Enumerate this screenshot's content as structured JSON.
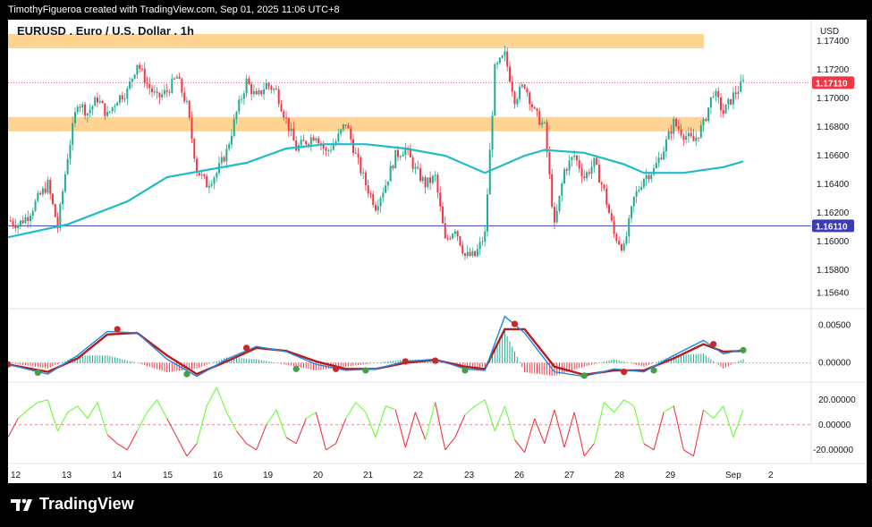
{
  "header": {
    "caption": "TimothyFigueroa created with TradingView.com, Sep 01, 2025 11:06 UTC+8"
  },
  "chart": {
    "symbol_title": "EURUSD . Euro / U.S. Dollar . 1h",
    "currency": "USD",
    "price_badge": "1.17110",
    "level_badge": "1.16110"
  },
  "brand": {
    "name": "TradingView",
    "icon": "tradingview-logo-icon"
  },
  "colors": {
    "up": "#22ab94",
    "down": "#f23645",
    "ma": "#1fbcc6",
    "zone": "#ffcc80",
    "macd_fast": "#1e88e5",
    "macd_slow": "#b71c1c",
    "osc_up": "#66ff33",
    "osc_down": "#f23645",
    "badge_red": "#f23645",
    "badge_blue": "#3b3bb3"
  },
  "chart_data": {
    "type": "candlestick",
    "timeframe": "1h",
    "price_axis": {
      "range": [
        1.1555,
        1.1755
      ],
      "ticks": [
        "1.17400",
        "1.17200",
        "1.17000",
        "1.16800",
        "1.16600",
        "1.16400",
        "1.16200",
        "1.16000",
        "1.15800",
        "1.15640"
      ]
    },
    "x_ticks": [
      "12",
      "13",
      "14",
      "15",
      "16",
      "19",
      "20",
      "21",
      "22",
      "23",
      "26",
      "27",
      "28",
      "29",
      "Sep",
      "2"
    ],
    "close_path": [
      [
        0,
        1.1615
      ],
      [
        1,
        1.1612
      ],
      [
        2,
        1.1618
      ],
      [
        3,
        1.163
      ],
      [
        4,
        1.164
      ],
      [
        5,
        1.161
      ],
      [
        6,
        1.166
      ],
      [
        7,
        1.1698
      ],
      [
        8,
        1.169
      ],
      [
        9,
        1.17
      ],
      [
        10,
        1.1688
      ],
      [
        11,
        1.17
      ],
      [
        12,
        1.1705
      ],
      [
        13,
        1.1725
      ],
      [
        14,
        1.171
      ],
      [
        15,
        1.17
      ],
      [
        16,
        1.1705
      ],
      [
        17,
        1.1715
      ],
      [
        18,
        1.1695
      ],
      [
        19,
        1.165
      ],
      [
        20,
        1.164
      ],
      [
        21,
        1.1648
      ],
      [
        22,
        1.1663
      ],
      [
        23,
        1.169
      ],
      [
        24,
        1.1712
      ],
      [
        25,
        1.17
      ],
      [
        26,
        1.171
      ],
      [
        27,
        1.1705
      ],
      [
        28,
        1.1685
      ],
      [
        29,
        1.1665
      ],
      [
        30,
        1.167
      ],
      [
        31,
        1.1675
      ],
      [
        32,
        1.1662
      ],
      [
        33,
        1.167
      ],
      [
        34,
        1.1683
      ],
      [
        35,
        1.166
      ],
      [
        36,
        1.164
      ],
      [
        37,
        1.1625
      ],
      [
        38,
        1.164
      ],
      [
        39,
        1.166
      ],
      [
        40,
        1.1665
      ],
      [
        41,
        1.165
      ],
      [
        42,
        1.164
      ],
      [
        43,
        1.1645
      ],
      [
        44,
        1.16
      ],
      [
        45,
        1.161
      ],
      [
        46,
        1.159
      ],
      [
        47,
        1.159
      ],
      [
        48,
        1.1605
      ],
      [
        49,
        1.172
      ],
      [
        50,
        1.173
      ],
      [
        51,
        1.17
      ],
      [
        52,
        1.171
      ],
      [
        53,
        1.169
      ],
      [
        54,
        1.168
      ],
      [
        55,
        1.161
      ],
      [
        56,
        1.165
      ],
      [
        57,
        1.166
      ],
      [
        58,
        1.1645
      ],
      [
        59,
        1.1655
      ],
      [
        60,
        1.1635
      ],
      [
        61,
        1.1605
      ],
      [
        62,
        1.1595
      ],
      [
        63,
        1.163
      ],
      [
        64,
        1.1645
      ],
      [
        65,
        1.165
      ],
      [
        66,
        1.1665
      ],
      [
        67,
        1.1683
      ],
      [
        68,
        1.1675
      ],
      [
        69,
        1.167
      ],
      [
        70,
        1.1682
      ],
      [
        71,
        1.1705
      ],
      [
        72,
        1.169
      ],
      [
        73,
        1.1702
      ],
      [
        74,
        1.1711
      ]
    ],
    "moving_average": [
      [
        0,
        1.1603
      ],
      [
        6,
        1.1612
      ],
      [
        12,
        1.1628
      ],
      [
        16,
        1.1645
      ],
      [
        20,
        1.165
      ],
      [
        24,
        1.1655
      ],
      [
        28,
        1.1665
      ],
      [
        32,
        1.1668
      ],
      [
        36,
        1.1668
      ],
      [
        40,
        1.1665
      ],
      [
        44,
        1.166
      ],
      [
        48,
        1.1648
      ],
      [
        52,
        1.166
      ],
      [
        54,
        1.1664
      ],
      [
        58,
        1.1662
      ],
      [
        62,
        1.1654
      ],
      [
        64,
        1.1648
      ],
      [
        68,
        1.1648
      ],
      [
        72,
        1.1652
      ],
      [
        74,
        1.1656
      ]
    ],
    "resistance_zones": [
      [
        1.1735,
        1.1745
      ],
      [
        1.1677,
        1.1687
      ]
    ],
    "reference_lines": [
      1.1711,
      1.1611
    ],
    "macd": {
      "axis_ticks": [
        "0.00500",
        "0.00000"
      ],
      "range": [
        -0.0022,
        0.007
      ],
      "fast": [
        [
          0,
          -0.0002
        ],
        [
          4,
          -0.0015
        ],
        [
          7,
          0.001
        ],
        [
          10,
          0.0042
        ],
        [
          13,
          0.004
        ],
        [
          16,
          0.0005
        ],
        [
          19,
          -0.0018
        ],
        [
          22,
          0.0005
        ],
        [
          25,
          0.0022
        ],
        [
          28,
          0.0015
        ],
        [
          31,
          -0.0002
        ],
        [
          34,
          -0.001
        ],
        [
          37,
          -0.0008
        ],
        [
          40,
          0.0002
        ],
        [
          43,
          0.0005
        ],
        [
          46,
          -0.0008
        ],
        [
          48,
          -0.001
        ],
        [
          50,
          0.0062
        ],
        [
          52,
          0.004
        ],
        [
          55,
          -0.0012
        ],
        [
          58,
          -0.0018
        ],
        [
          61,
          -0.0008
        ],
        [
          64,
          -0.0012
        ],
        [
          67,
          0.001
        ],
        [
          70,
          0.003
        ],
        [
          72,
          0.0012
        ],
        [
          74,
          0.0018
        ]
      ],
      "slow": [
        [
          0,
          -0.0002
        ],
        [
          4,
          -0.0012
        ],
        [
          7,
          0.0006
        ],
        [
          10,
          0.0038
        ],
        [
          13,
          0.004
        ],
        [
          16,
          0.001
        ],
        [
          19,
          -0.0015
        ],
        [
          22,
          0.0002
        ],
        [
          25,
          0.002
        ],
        [
          28,
          0.0016
        ],
        [
          31,
          0.0002
        ],
        [
          34,
          -0.0008
        ],
        [
          37,
          -0.0008
        ],
        [
          40,
          0.0
        ],
        [
          43,
          0.0004
        ],
        [
          46,
          -0.0005
        ],
        [
          48,
          -0.0008
        ],
        [
          50,
          0.0045
        ],
        [
          52,
          0.0045
        ],
        [
          55,
          -0.0005
        ],
        [
          58,
          -0.0016
        ],
        [
          61,
          -0.001
        ],
        [
          64,
          -0.001
        ],
        [
          67,
          0.0006
        ],
        [
          70,
          0.0025
        ],
        [
          72,
          0.0015
        ],
        [
          74,
          0.0016
        ]
      ],
      "cross_points": [
        [
          0,
          -0.0002,
          "down"
        ],
        [
          3,
          -0.0013,
          "up"
        ],
        [
          11,
          0.0045,
          "down"
        ],
        [
          18,
          -0.0015,
          "up"
        ],
        [
          24,
          0.002,
          "down"
        ],
        [
          29,
          -0.0008,
          "up"
        ],
        [
          33,
          -0.0008,
          "down"
        ],
        [
          36,
          -0.001,
          "up"
        ],
        [
          40,
          0.0002,
          "down"
        ],
        [
          43,
          0.0003,
          "down"
        ],
        [
          46,
          -0.001,
          "up"
        ],
        [
          51,
          0.0052,
          "down"
        ],
        [
          58,
          -0.0017,
          "up"
        ],
        [
          62,
          -0.0012,
          "down"
        ],
        [
          65,
          -0.001,
          "up"
        ],
        [
          71,
          0.0025,
          "down"
        ],
        [
          74,
          0.0017,
          "up"
        ]
      ]
    },
    "oscillator": {
      "axis_ticks": [
        "20.00000",
        "0.00000",
        "-20.00000"
      ],
      "range": [
        -28,
        32
      ],
      "values": [
        [
          0,
          -10
        ],
        [
          1,
          5
        ],
        [
          2,
          12
        ],
        [
          3,
          18
        ],
        [
          4,
          20
        ],
        [
          5,
          -5
        ],
        [
          6,
          10
        ],
        [
          7,
          15
        ],
        [
          8,
          5
        ],
        [
          9,
          18
        ],
        [
          10,
          -8
        ],
        [
          11,
          -15
        ],
        [
          12,
          -20
        ],
        [
          13,
          -5
        ],
        [
          14,
          10
        ],
        [
          15,
          20
        ],
        [
          16,
          5
        ],
        [
          17,
          -10
        ],
        [
          18,
          -25
        ],
        [
          19,
          -15
        ],
        [
          20,
          15
        ],
        [
          21,
          30
        ],
        [
          22,
          10
        ],
        [
          23,
          -5
        ],
        [
          24,
          -15
        ],
        [
          25,
          -20
        ],
        [
          26,
          0
        ],
        [
          27,
          12
        ],
        [
          28,
          -10
        ],
        [
          29,
          -15
        ],
        [
          30,
          5
        ],
        [
          31,
          10
        ],
        [
          32,
          -20
        ],
        [
          33,
          -15
        ],
        [
          34,
          5
        ],
        [
          35,
          18
        ],
        [
          36,
          10
        ],
        [
          37,
          -10
        ],
        [
          38,
          15
        ],
        [
          39,
          12
        ],
        [
          40,
          -18
        ],
        [
          41,
          10
        ],
        [
          42,
          -12
        ],
        [
          43,
          18
        ],
        [
          44,
          -20
        ],
        [
          45,
          -10
        ],
        [
          46,
          8
        ],
        [
          47,
          15
        ],
        [
          48,
          20
        ],
        [
          49,
          -5
        ],
        [
          50,
          15
        ],
        [
          51,
          -12
        ],
        [
          52,
          -22
        ],
        [
          53,
          5
        ],
        [
          54,
          -15
        ],
        [
          55,
          12
        ],
        [
          56,
          -18
        ],
        [
          57,
          10
        ],
        [
          58,
          -25
        ],
        [
          59,
          -15
        ],
        [
          60,
          18
        ],
        [
          61,
          10
        ],
        [
          62,
          20
        ],
        [
          63,
          15
        ],
        [
          64,
          -15
        ],
        [
          65,
          -20
        ],
        [
          66,
          10
        ],
        [
          67,
          15
        ],
        [
          68,
          -20
        ],
        [
          69,
          -25
        ],
        [
          70,
          12
        ],
        [
          71,
          5
        ],
        [
          72,
          15
        ],
        [
          73,
          -10
        ],
        [
          74,
          12
        ]
      ]
    }
  }
}
